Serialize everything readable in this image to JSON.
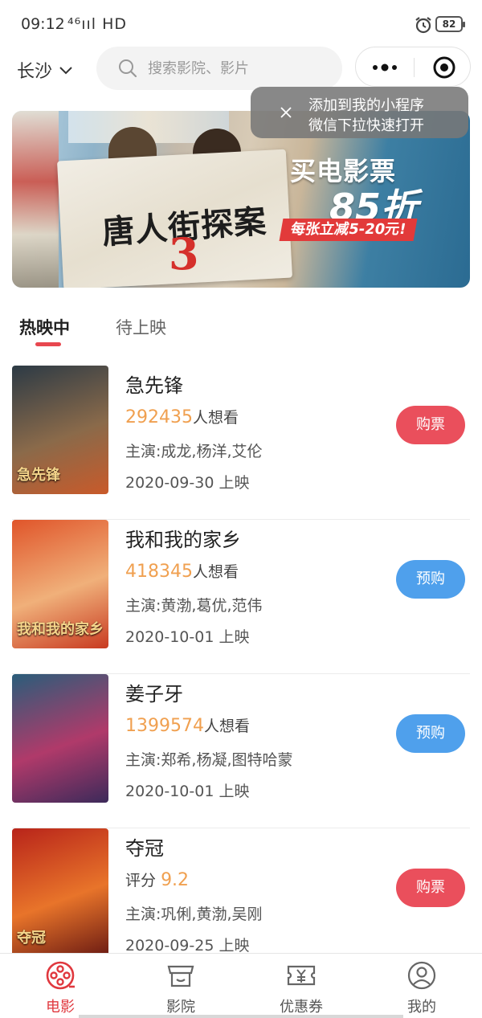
{
  "status_bar": {
    "time": "09:12",
    "network": "⁴⁶ııl HD",
    "battery": "82"
  },
  "header": {
    "city": "长沙",
    "search_placeholder": "搜索影院、影片"
  },
  "tooltip": {
    "line1": "添加到我的小程序",
    "line2": "微信下拉快速打开"
  },
  "banner": {
    "movie_title": "唐人街探案",
    "movie_number": "3",
    "headline": "买电影票",
    "discount": "85折",
    "promo": "每张立减5-20元!"
  },
  "tabs": [
    {
      "label": "热映中",
      "active": true
    },
    {
      "label": "待上映",
      "active": false
    }
  ],
  "movies": [
    {
      "title": "急先锋",
      "metric_value": "292435",
      "metric_suffix": "人想看",
      "cast": "主演:成龙,杨洋,艾伦",
      "date": "2020-09-30 上映",
      "button": "购票",
      "button_color": "#ea4f5c",
      "poster_caption": "急先锋",
      "poster_colors": [
        "#2c3a45",
        "#8a6a4a",
        "#c95a2a"
      ]
    },
    {
      "title": "我和我的家乡",
      "metric_value": "418345",
      "metric_suffix": "人想看",
      "cast": "主演:黄渤,葛优,范伟",
      "date": "2020-10-01 上映",
      "button": "预购",
      "button_color": "#4fa0ec",
      "poster_caption": "我和我的家乡",
      "poster_colors": [
        "#e0552a",
        "#f0b07a",
        "#c83a20"
      ]
    },
    {
      "title": "姜子牙",
      "metric_value": "1399574",
      "metric_suffix": "人想看",
      "cast": "主演:郑希,杨凝,图特哈蒙",
      "date": "2020-10-01 上映",
      "button": "预购",
      "button_color": "#4fa0ec",
      "poster_caption": "",
      "poster_colors": [
        "#2a5d7a",
        "#b03a6a",
        "#3c2a5a"
      ]
    },
    {
      "title": "夺冠",
      "metric_prefix": "评分",
      "metric_value": "9.2",
      "cast": "主演:巩俐,黄渤,吴刚",
      "date": "2020-09-25 上映",
      "button": "购票",
      "button_color": "#ea4f5c",
      "poster_caption": "夺冠",
      "poster_colors": [
        "#b8241a",
        "#e8742a",
        "#6a1a12"
      ]
    }
  ],
  "bottom_nav": [
    {
      "label": "电影",
      "icon": "film-reel-icon",
      "active": true
    },
    {
      "label": "影院",
      "icon": "cinema-icon",
      "active": false
    },
    {
      "label": "优惠券",
      "icon": "coupon-icon",
      "active": false
    },
    {
      "label": "我的",
      "icon": "user-icon",
      "active": false
    }
  ],
  "colors": {
    "accent_red": "#e8474f",
    "metric_orange": "#f0a050",
    "preorder_blue": "#4fa0ec",
    "buy_red": "#ea4f5c"
  }
}
